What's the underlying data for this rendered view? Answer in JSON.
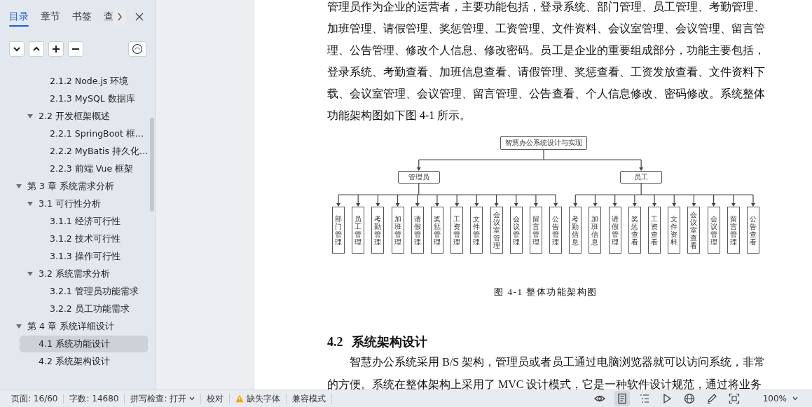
{
  "sidebar": {
    "tabs": [
      {
        "label": "目录",
        "selected": true
      },
      {
        "label": "章节",
        "selected": false
      },
      {
        "label": "书签",
        "selected": false
      },
      {
        "label": "查",
        "selected": false
      }
    ],
    "tree": [
      {
        "children": [
          {
            "children": [
              {
                "label": "2.1.2 Node.js 环境",
                "selected": false
              },
              {
                "label": "2.1.3 MySQL 数据库",
                "selected": false
              }
            ]
          },
          {
            "label": "2.2 开发框架概述",
            "expanded": true,
            "selected": false,
            "children": [
              {
                "label": "2.2.1 SpringBoot 框…",
                "selected": false
              },
              {
                "label": "2.2.2 MyBatis 持久化…",
                "selected": false
              },
              {
                "label": "2.2.3 前端 Vue 框架",
                "selected": false
              }
            ]
          }
        ]
      },
      {
        "label": "第 3 章 系统需求分析",
        "expanded": true,
        "selected": false,
        "children": [
          {
            "label": "3.1 可行性分析",
            "expanded": true,
            "selected": false,
            "children": [
              {
                "label": "3.1.1 经济可行性",
                "selected": false
              },
              {
                "label": "3.1.2 技术可行性",
                "selected": false
              },
              {
                "label": "3.1.3 操作可行性",
                "selected": false
              }
            ]
          },
          {
            "label": "3.2 系统需求分析",
            "expanded": true,
            "selected": false,
            "children": [
              {
                "label": "3.2.1 管理员功能需求",
                "selected": false
              },
              {
                "label": "3.2.2 员工功能需求",
                "selected": false
              }
            ]
          }
        ]
      },
      {
        "label": "第 4 章 系统详细设计",
        "expanded": true,
        "selected": false,
        "children": [
          {
            "label": "4.1 系统功能设计",
            "selected": true
          },
          {
            "label": "4.2 系统架构设计",
            "selected": false
          }
        ]
      }
    ]
  },
  "document": {
    "intro_paragraph": "管理员作为企业的运营者，主要功能包括，登录系统、部门管理、员工管理、考勤管理、加班管理、请假管理、奖惩管理、工资管理、文件资料、会议室管理、会议管理、留言管理、公告管理、修改个人信息、修改密码。员工是企业的重要组成部分，功能主要包括，登录系统、考勤查看、加班信息查看、请假管理、奖惩查看、工资发放查看、文件资料下载、会议室管理、会议管理、留言管理、公告查看、个人信息修改、密码修改。系统整体功能架构图如下图 4-1 所示。",
    "diagram": {
      "root": "智慧办公系统设计与实现",
      "branches": [
        {
          "label": "管理员",
          "children": [
            "部门管理",
            "员工管理",
            "考勤管理",
            "加班管理",
            "请假管理",
            "奖惩管理",
            "工资管理",
            "文件管理",
            "会议室管理",
            "会议管理",
            "留言管理",
            "公告管理"
          ]
        },
        {
          "label": "员工",
          "children": [
            "考勤信息",
            "加班信息",
            "请假管理",
            "奖惩查看",
            "工资查看",
            "文件资料",
            "会议室查看",
            "会议管理",
            "留言管理",
            "公告查看"
          ]
        }
      ]
    },
    "caption": "图 4-1 整体功能架构图",
    "heading": {
      "number": "4.2",
      "title": "系统架构设计"
    },
    "body_paragraph": "智慧办公系统采用 B/S 架构，管理员或者员工通过电脑浏览器就可以访问系统，非常的方便。系统在整体架构上采用了 MVC 设计模式，它是一种软件设计规范，通过将业务"
  },
  "status_bar": {
    "items": [
      {
        "kind": "text",
        "label": "页面: 16/60"
      },
      {
        "kind": "text",
        "label": "字数: 14680"
      },
      {
        "kind": "dropdown",
        "label": "拼写检查: 打开"
      },
      {
        "kind": "button",
        "label": "校对"
      },
      {
        "kind": "warning",
        "label": "缺失字体"
      },
      {
        "kind": "button",
        "label": "兼容模式"
      }
    ],
    "tools": [
      {
        "kind": "eye",
        "selected": false
      },
      {
        "kind": "page",
        "selected": true
      },
      {
        "kind": "list",
        "selected": false
      },
      {
        "kind": "play",
        "selected": false
      },
      {
        "kind": "globe",
        "selected": false
      },
      {
        "kind": "pen",
        "selected": false
      },
      {
        "kind": "fit",
        "selected": false
      }
    ],
    "zoom": "100%"
  }
}
